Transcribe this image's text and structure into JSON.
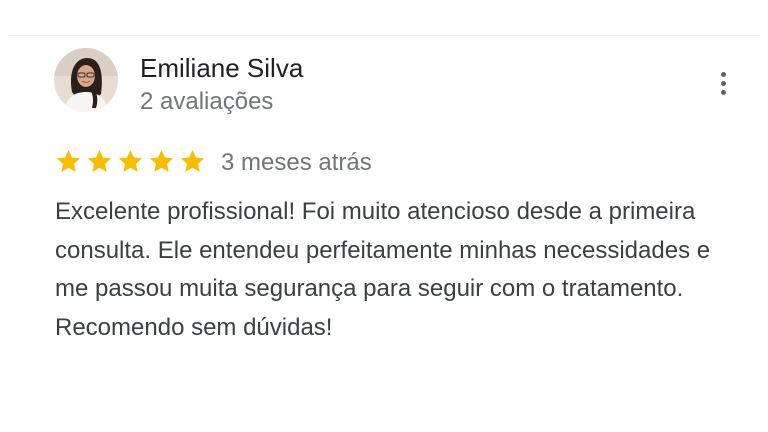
{
  "reviewer": {
    "name": "Emiliane Silva",
    "review_count": "2 avaliações",
    "avatar_icon": "user-photo"
  },
  "review": {
    "rating": 5,
    "rating_max": 5,
    "star_color": "#fbbc04",
    "date": "3 meses atrás",
    "text": "Excelente profissional! Foi muito atencioso desde a primeira consulta. Ele entendeu perfeitamente minhas necessidades e me passou muita segurança para seguir com o tratamento. Recomendo sem dúvidas!"
  },
  "actions": {
    "more_icon": "more-vert-icon"
  }
}
